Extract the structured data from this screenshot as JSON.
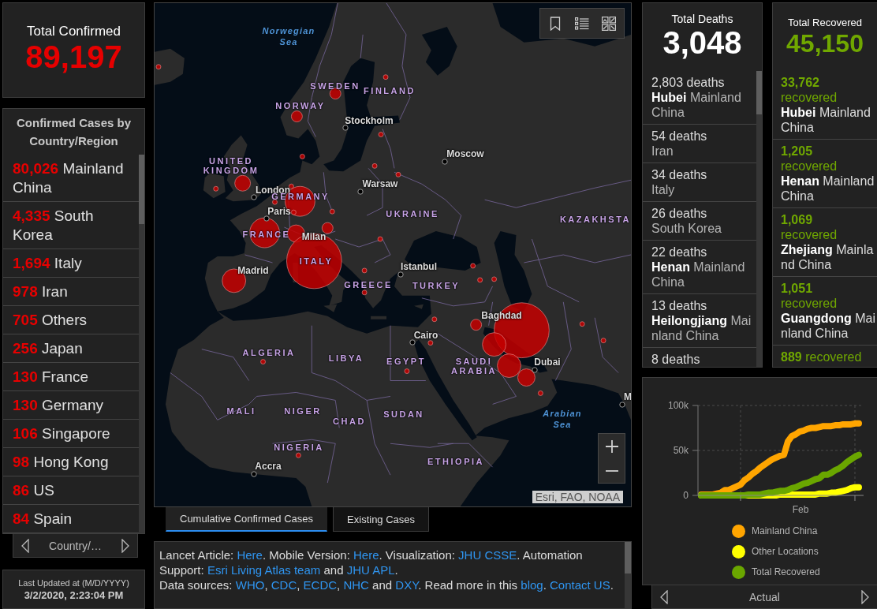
{
  "confirmed": {
    "title": "Total Confirmed",
    "total": "89,197"
  },
  "country_list": {
    "title": "Confirmed Cases by Country/Region",
    "rows": [
      {
        "count": "80,026",
        "name": "Mainland China"
      },
      {
        "count": "4,335",
        "name": "South Korea"
      },
      {
        "count": "1,694",
        "name": "Italy"
      },
      {
        "count": "978",
        "name": "Iran"
      },
      {
        "count": "705",
        "name": "Others"
      },
      {
        "count": "256",
        "name": "Japan"
      },
      {
        "count": "130",
        "name": "France"
      },
      {
        "count": "130",
        "name": "Germany"
      },
      {
        "count": "106",
        "name": "Singapore"
      },
      {
        "count": "98",
        "name": "Hong Kong"
      },
      {
        "count": "86",
        "name": "US"
      },
      {
        "count": "84",
        "name": "Spain"
      }
    ],
    "pager": {
      "label": "Country/…"
    }
  },
  "last_updated": {
    "label": "Last Updated at (M/D/YYYY)",
    "value": "3/2/2020, 2:23:04 PM"
  },
  "map": {
    "labels": [
      {
        "kind": "sea",
        "text": "Norwegian Sea"
      },
      {
        "kind": "country",
        "text": "SWEDEN"
      },
      {
        "kind": "country",
        "text": "FINLAND"
      },
      {
        "kind": "country",
        "text": "NORWAY"
      },
      {
        "kind": "city",
        "text": "Stockholm"
      },
      {
        "kind": "city",
        "text": "Moscow"
      },
      {
        "kind": "country",
        "text": "UNITED KINGDOM"
      },
      {
        "kind": "city",
        "text": "London"
      },
      {
        "kind": "city",
        "text": "Warsaw"
      },
      {
        "kind": "country",
        "text": "GERMANY"
      },
      {
        "kind": "city",
        "text": "Paris"
      },
      {
        "kind": "country",
        "text": "UKRAINE"
      },
      {
        "kind": "country",
        "text": "KAZAKHSTA"
      },
      {
        "kind": "country",
        "text": "FRANCE"
      },
      {
        "kind": "city",
        "text": "Milan"
      },
      {
        "kind": "country",
        "text": "ITALY"
      },
      {
        "kind": "city",
        "text": "Madrid"
      },
      {
        "kind": "city",
        "text": "Istanbul"
      },
      {
        "kind": "country",
        "text": "GREECE"
      },
      {
        "kind": "country",
        "text": "TURKEY"
      },
      {
        "kind": "city",
        "text": "Baghdad"
      },
      {
        "kind": "city",
        "text": "Cairo"
      },
      {
        "kind": "country",
        "text": "ALGERIA"
      },
      {
        "kind": "country",
        "text": "LIBYA"
      },
      {
        "kind": "country",
        "text": "EGYPT"
      },
      {
        "kind": "country",
        "text": "SAUDI ARABIA"
      },
      {
        "kind": "city",
        "text": "Dubai"
      },
      {
        "kind": "city",
        "text": "M"
      },
      {
        "kind": "country",
        "text": "MALI"
      },
      {
        "kind": "country",
        "text": "NIGER"
      },
      {
        "kind": "country",
        "text": "CHAD"
      },
      {
        "kind": "country",
        "text": "SUDAN"
      },
      {
        "kind": "sea",
        "text": "Arabian Sea"
      },
      {
        "kind": "country",
        "text": "NIGERIA"
      },
      {
        "kind": "city",
        "text": "Accra"
      },
      {
        "kind": "country",
        "text": "ETHIOPIA"
      }
    ],
    "attribution": "Esri, FAO, NOAA"
  },
  "map_tabs": [
    {
      "label": "Cumulative Confirmed Cases",
      "selected": true
    },
    {
      "label": "Existing Cases",
      "selected": false
    }
  ],
  "info": {
    "paragraphs": [
      [
        {
          "kind": "text",
          "text": "Lancet Article: "
        },
        {
          "kind": "link",
          "text": "Here"
        },
        {
          "kind": "text",
          "text": ". Mobile Version: "
        },
        {
          "kind": "link",
          "text": "Here"
        },
        {
          "kind": "text",
          "text": ". Visualization: "
        },
        {
          "kind": "link",
          "text": "JHU CSSE"
        },
        {
          "kind": "text",
          "text": ". Automation Support: "
        },
        {
          "kind": "link",
          "text": "Esri Living Atlas team"
        },
        {
          "kind": "text",
          "text": " and "
        },
        {
          "kind": "link",
          "text": "JHU APL"
        },
        {
          "kind": "text",
          "text": "."
        }
      ],
      [
        {
          "kind": "text",
          "text": "Data sources: "
        },
        {
          "kind": "link",
          "text": "WHO"
        },
        {
          "kind": "text",
          "text": ", "
        },
        {
          "kind": "link",
          "text": "CDC"
        },
        {
          "kind": "text",
          "text": ", "
        },
        {
          "kind": "link",
          "text": "ECDC"
        },
        {
          "kind": "text",
          "text": ", "
        },
        {
          "kind": "link",
          "text": "NHC"
        },
        {
          "kind": "text",
          "text": " and "
        },
        {
          "kind": "link",
          "text": "DXY"
        },
        {
          "kind": "text",
          "text": ". Read more in this "
        },
        {
          "kind": "link",
          "text": "blog"
        },
        {
          "kind": "text",
          "text": ". "
        },
        {
          "kind": "link",
          "text": "Contact US"
        },
        {
          "kind": "text",
          "text": "."
        }
      ]
    ]
  },
  "deaths": {
    "title": "Total Deaths",
    "total": "3,048",
    "rows": [
      {
        "count": "2,803 deaths",
        "place": "**Hubei** Mainland China"
      },
      {
        "count": "54 deaths",
        "place": "Iran"
      },
      {
        "count": "34 deaths",
        "place": "Italy"
      },
      {
        "count": "26 deaths",
        "place": "South Korea"
      },
      {
        "count": "22 deaths",
        "place": "**Henan** Mainland China"
      },
      {
        "count": "13 deaths",
        "place": "**Heilongjiang** Mainland China"
      },
      {
        "count": "8 deaths"
      }
    ]
  },
  "recovered": {
    "title": "Total Recovered",
    "total": "45,150",
    "rows": [
      {
        "count": "**33,762** recovered",
        "place": "**Hubei** Mainland China"
      },
      {
        "count": "**1,205** recovered",
        "place": "**Henan** Mainland China"
      },
      {
        "count": "**1,069** recovered",
        "place": "**Zhejiang** Mainland China"
      },
      {
        "count": "**1,051** recovered",
        "place": "**Guangdong** Mainland China"
      },
      {
        "count": "**889** recovered"
      }
    ]
  },
  "chart": {
    "chart_data": {
      "type": "line",
      "xlabel": "Feb",
      "yticks": [
        {
          "value": 0,
          "label": "0"
        },
        {
          "value": 50000,
          "label": "50k"
        },
        {
          "value": 100000,
          "label": "100k"
        }
      ],
      "ylim": [
        0,
        100000
      ],
      "grid": true,
      "legend": "bottom",
      "series": [
        {
          "name": "Mainland China",
          "color": "#ffa500",
          "values": [
            1000,
            1000,
            1000,
            1000,
            2000,
            3000,
            6000,
            6000,
            8000,
            10000,
            12000,
            17000,
            20000,
            24000,
            27000,
            31000,
            34000,
            37000,
            40000,
            42000,
            44000,
            45000,
            60000,
            66000,
            68000,
            71000,
            72000,
            74000,
            75000,
            75000,
            76000,
            77000,
            77000,
            77000,
            78000,
            78000,
            79000,
            79000,
            79000,
            80000,
            80000
          ]
        },
        {
          "name": "Other Locations",
          "color": "#ffff00",
          "values": [
            0,
            0,
            0,
            0,
            0,
            0,
            0,
            0,
            0,
            0,
            0,
            0,
            0,
            0,
            0,
            0,
            0,
            0,
            0,
            0,
            1000,
            1000,
            1000,
            1000,
            1000,
            1000,
            1000,
            1000,
            1000,
            1000,
            2000,
            2000,
            2000,
            3000,
            3000,
            4000,
            5000,
            6000,
            8000,
            9000,
            9000
          ]
        },
        {
          "name": "Total Recovered",
          "color": "#6aa600",
          "values": [
            0,
            0,
            0,
            0,
            0,
            0,
            0,
            0,
            0,
            0,
            0,
            0,
            1000,
            1000,
            1000,
            1000,
            2000,
            3000,
            3000,
            4000,
            5000,
            5000,
            6000,
            8000,
            9000,
            11000,
            13000,
            14000,
            16000,
            18000,
            19000,
            23000,
            23000,
            25000,
            28000,
            30000,
            33000,
            37000,
            40000,
            43000,
            45000
          ]
        }
      ]
    },
    "pager": {
      "label": "Actual"
    }
  }
}
